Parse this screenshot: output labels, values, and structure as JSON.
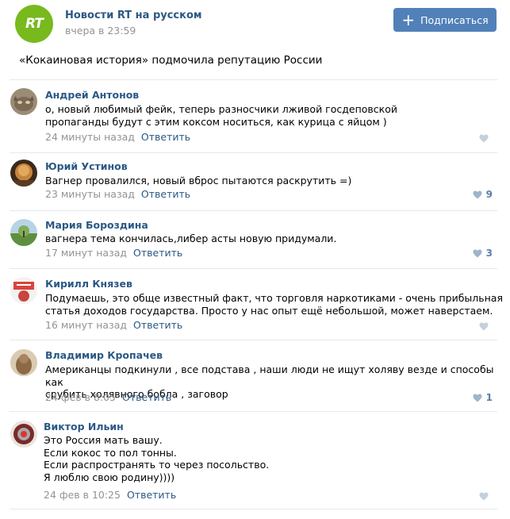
{
  "post": {
    "community": "Новости RT на русском",
    "logo_text": "RT",
    "time": "вчера в 23:59",
    "subscribe_label": "Подписаться",
    "subscribe_icon": "plus-icon",
    "text": "«Кокаиновая история» подмочила репутацию России"
  },
  "comments": [
    {
      "author": "Андрей Антонов",
      "text": "о, новый любимый фейк, теперь разносчики лживой госдеповской\nпропаганды будут с этим коксом носиться, как курица с яйцом )",
      "time": "24 минуты назад",
      "reply": "Ответить",
      "likes": "",
      "avatar_color": "#8a7a68"
    },
    {
      "author": "Юрий Устинов",
      "text": "Вагнер провалился, новый вброс пытаются раскрутить =)",
      "time": "23 минуты назад",
      "reply": "Ответить",
      "likes": "9",
      "avatar_color": "#b87a3a"
    },
    {
      "author": "Мария Бороздина",
      "text": "вагнера тема кончилась,либер асты новую придумали.",
      "time": "17 минут назад",
      "reply": "Ответить",
      "likes": "3",
      "avatar_color": "#6f9a58"
    },
    {
      "author": "Кирилл Князев",
      "text": "Подумаешь, это обще известный факт, что торговля наркотиками - очень прибыльная\nстатья доходов государства. Просто у нас опыт ещё небольшой, может наверстаем.",
      "time": "16 минут назад",
      "reply": "Ответить",
      "likes": "",
      "avatar_color": "#c9453f"
    },
    {
      "author": "Владимир Кропачев",
      "text": "Американцы подкинули , все подстава , наши люди не ищут холяву везде и способы как\nсрубить холявного бобла , заговор",
      "time": "24 фев в 8:05",
      "reply": "Ответить",
      "likes": "1",
      "avatar_color": "#8c6a48"
    },
    {
      "author": "Виктор Ильин",
      "text": "Это Россия мать вашу.\nЕсли кокос то пол тонны.\nЕсли распространять то через посольство.\nЯ люблю свою родину))))",
      "time": "24 фев в 10:25",
      "reply": "Ответить",
      "likes": "",
      "avatar_color": "#7a2a2a"
    }
  ],
  "icons": {
    "like": "heart-icon"
  },
  "colors": {
    "link": "#2a5885",
    "button": "#5181b8",
    "meta": "#939393",
    "logo": "#78b91e"
  }
}
